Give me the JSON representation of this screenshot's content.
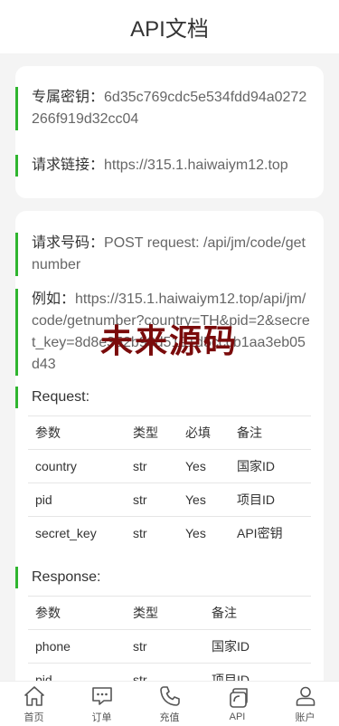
{
  "header": {
    "title": "API文档"
  },
  "key_card": {
    "secret_label": "专属密钥：",
    "secret_value": "6d35c769cdc5e534fdd94a0272266f919d32cc04",
    "link_label": "请求链接：",
    "link_value": "https://315.1.haiwaiym12.top"
  },
  "api_card": {
    "request_label": "请求号码：",
    "request_value": "POST request: /api/jm/code/getnumber",
    "example_label": "例如：",
    "example_value": "https://315.1.haiwaiym12.top/api/jm/code/getnumber?country=TH&pid=2&secret_key=8d8e352b98d5191d5cccb1aa3eb05d43",
    "request_title": "Request:",
    "request_table": {
      "headers": [
        "参数",
        "类型",
        "必填",
        "备注"
      ],
      "rows": [
        [
          "country",
          "str",
          "Yes",
          "国家ID"
        ],
        [
          "pid",
          "str",
          "Yes",
          "项目ID"
        ],
        [
          "secret_key",
          "str",
          "Yes",
          "API密钥"
        ]
      ]
    },
    "response_title": "Response:",
    "response_table": {
      "headers": [
        "参数",
        "类型",
        "备注"
      ],
      "rows": [
        [
          "phone",
          "str",
          "国家ID"
        ],
        [
          "pid",
          "str",
          "项目ID"
        ]
      ]
    }
  },
  "watermark": "未来源码",
  "tabbar": {
    "items": [
      {
        "label": "首页",
        "icon": "home-icon"
      },
      {
        "label": "订单",
        "icon": "chat-icon"
      },
      {
        "label": "充值",
        "icon": "phone-icon"
      },
      {
        "label": "API",
        "icon": "api-icon"
      },
      {
        "label": "账户",
        "icon": "user-icon"
      }
    ]
  },
  "colors": {
    "accent": "#2fb52f",
    "watermark": "#7a0b0b"
  }
}
